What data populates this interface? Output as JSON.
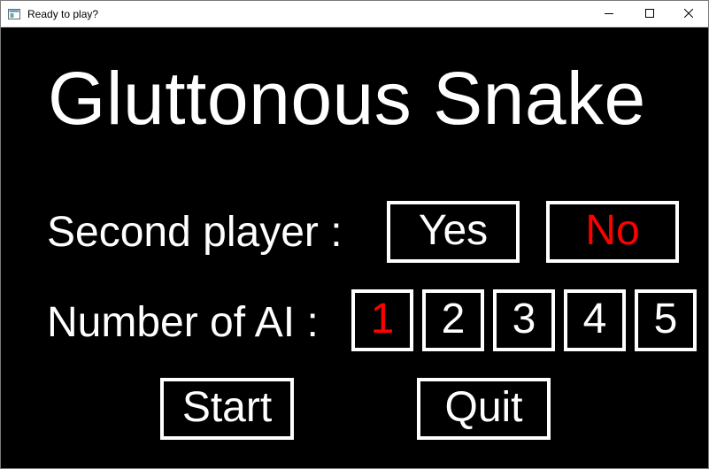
{
  "window": {
    "title": "Ready to play?",
    "icon": "app-window-icon",
    "controls": {
      "minimize_icon": "minimize-icon",
      "maximize_icon": "maximize-icon",
      "close_icon": "close-icon"
    }
  },
  "menu": {
    "title": "Gluttonous Snake",
    "second_player": {
      "label": "Second player :",
      "options": [
        "Yes",
        "No"
      ],
      "selected": "No"
    },
    "ai": {
      "label": "Number of AI :",
      "options": [
        "1",
        "2",
        "3",
        "4",
        "5"
      ],
      "selected": "1"
    },
    "actions": {
      "start": "Start",
      "quit": "Quit"
    }
  },
  "colors": {
    "background": "#000000",
    "text": "#ffffff",
    "selected": "#ff0000",
    "border": "#ffffff"
  }
}
